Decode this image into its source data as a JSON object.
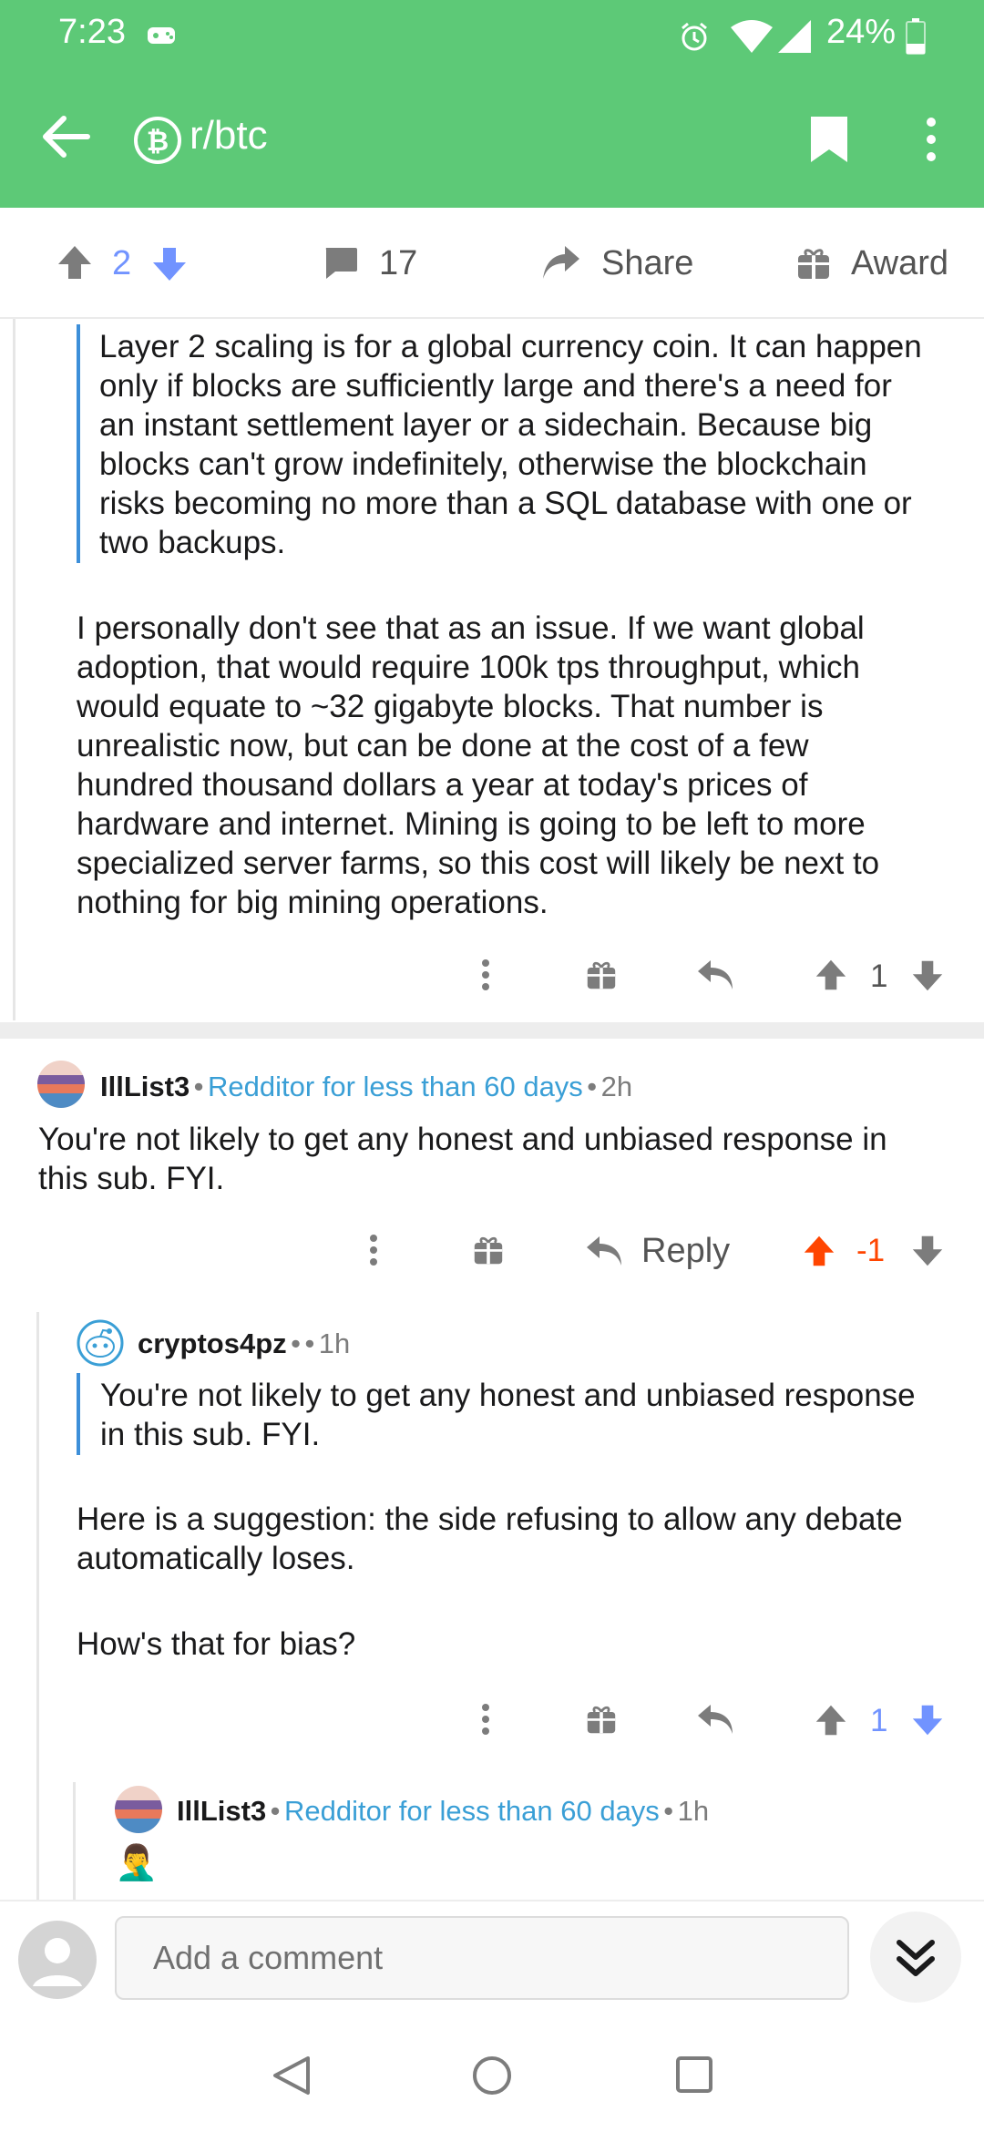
{
  "status": {
    "time": "7:23",
    "battery": "24%"
  },
  "header": {
    "subreddit": "r/btc"
  },
  "actions": {
    "score": "2",
    "comments": "17",
    "share": "Share",
    "award": "Award"
  },
  "thread": {
    "parent": {
      "quote": [
        "Layer 2 scaling is for a global currency coin. It can happen",
        "only if blocks are sufficiently large and there's a need for",
        "an instant settlement layer or a sidechain. Because big",
        "blocks can't grow indefinitely, otherwise the blockchain",
        "risks becoming no more than a SQL database with one or",
        "two backups."
      ],
      "body": [
        "I personally don't see that as an issue. If we want global",
        "adoption, that would require 100k tps throughput, which",
        "would equate to ~32 gigabyte blocks. That number is",
        "unrealistic now, but can be done at the cost of a few",
        "hundred thousand dollars a year at today's prices of",
        "hardware and internet. Mining is going to be left to more",
        "specialized server farms, so this cost will likely be next to",
        "nothing for big mining operations."
      ],
      "score": "1"
    },
    "comment1": {
      "username": "IllList3",
      "flair": "Redditor for less than 60 days",
      "time": "2h",
      "body": [
        "You're not likely to get any honest and unbiased response in",
        "this sub.  FYI."
      ],
      "reply_label": "Reply",
      "score": "-1"
    },
    "comment2": {
      "username": "cryptos4pz",
      "time": "1h",
      "quote": [
        "You're not likely to get any honest and unbiased response",
        "in this sub. FYI."
      ],
      "body1": [
        "Here is a suggestion: the side refusing to allow any debate",
        "automatically loses."
      ],
      "body2": "How's that for bias?",
      "score": "1"
    },
    "comment3": {
      "username": "IllList3",
      "flair": "Redditor for less than 60 days",
      "time": "1h",
      "emoji": "🤦‍♂️"
    }
  },
  "composer": {
    "placeholder": "Add a comment"
  },
  "colors": {
    "header": "#5dc977",
    "upvote_active": "#ff4500",
    "downvote_active": "#7193ff",
    "flair": "#3a9fd6"
  }
}
